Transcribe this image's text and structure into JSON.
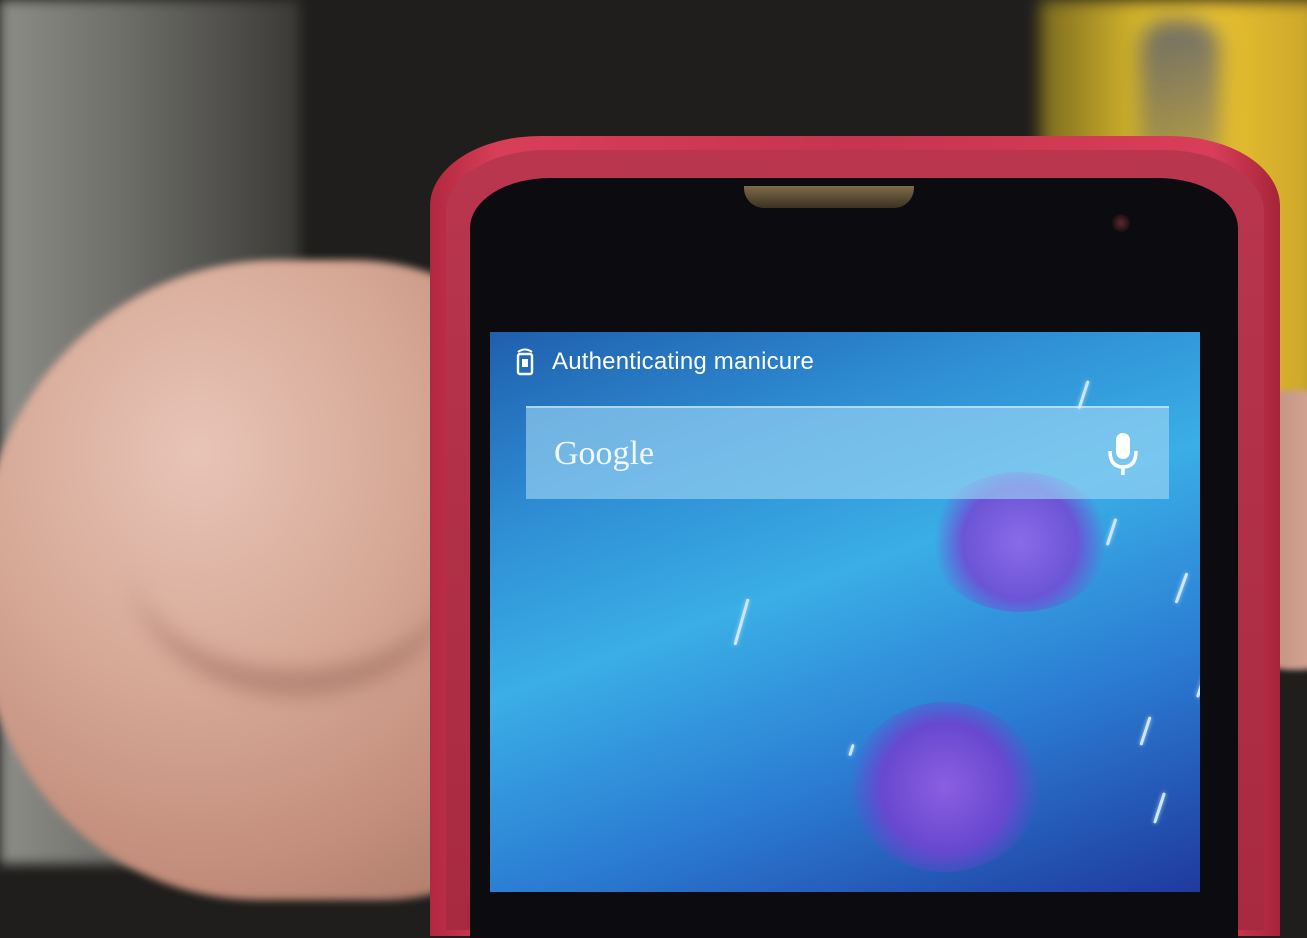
{
  "status_bar": {
    "notification_text": "Authenticating manicure",
    "notification_icon": "nfc-phone-icon"
  },
  "search_widget": {
    "logo_text": "Google",
    "mic_icon": "microphone-icon"
  },
  "colors": {
    "phone_case": "#c6344d",
    "screen_blue": "#3aaee6",
    "search_bar": "#a0d7f5"
  }
}
